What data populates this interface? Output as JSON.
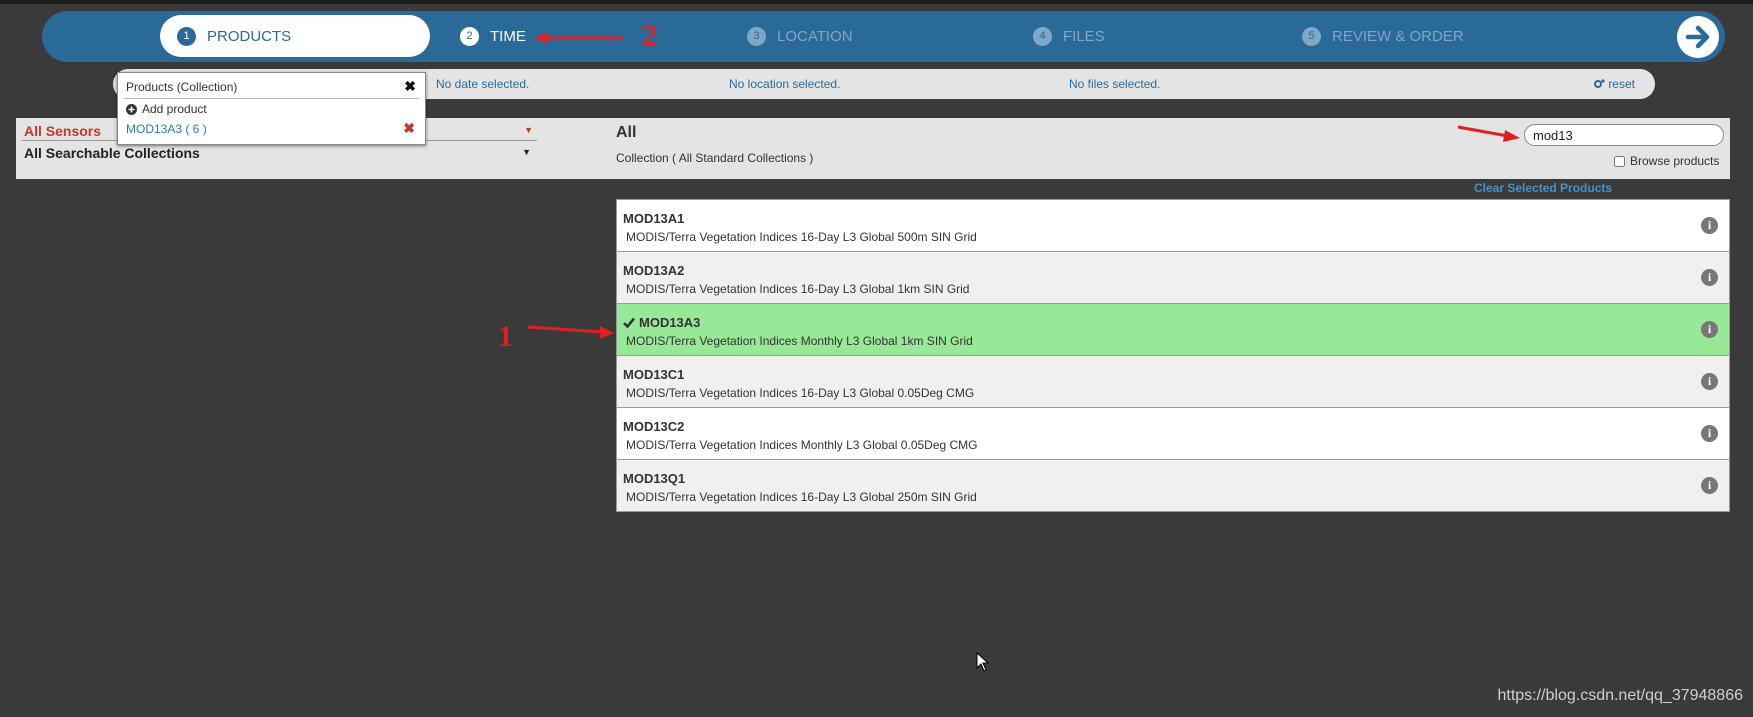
{
  "steps": [
    {
      "num": "1",
      "label": "PRODUCTS"
    },
    {
      "num": "2",
      "label": "TIME"
    },
    {
      "num": "3",
      "label": "LOCATION"
    },
    {
      "num": "4",
      "label": "FILES"
    },
    {
      "num": "5",
      "label": "REVIEW & ORDER"
    }
  ],
  "summary": {
    "date": "No date selected.",
    "location": "No location selected.",
    "files": "No files selected.",
    "reset": "reset"
  },
  "popup": {
    "title": "Products (Collection)",
    "close": "✖",
    "add": "Add product",
    "item": "MOD13A3 ( 6 )",
    "remove": "✖"
  },
  "filters": {
    "sensor": "All Sensors",
    "collection": "All Searchable Collections",
    "heading": "All",
    "subheading": "Collection ( All Standard Collections )",
    "search_value": "mod13",
    "browse_label": "Browse products",
    "clear": "Clear Selected Products"
  },
  "products": [
    {
      "name": "MOD13A1",
      "desc": "MODIS/Terra Vegetation Indices 16-Day L3 Global 500m SIN Grid",
      "selected": false
    },
    {
      "name": "MOD13A2",
      "desc": "MODIS/Terra Vegetation Indices 16-Day L3 Global 1km SIN Grid",
      "selected": false
    },
    {
      "name": "MOD13A3",
      "desc": "MODIS/Terra Vegetation Indices Monthly L3 Global 1km SIN Grid",
      "selected": true
    },
    {
      "name": "MOD13C1",
      "desc": "MODIS/Terra Vegetation Indices 16-Day L3 Global 0.05Deg CMG",
      "selected": false
    },
    {
      "name": "MOD13C2",
      "desc": "MODIS/Terra Vegetation Indices Monthly L3 Global 0.05Deg CMG",
      "selected": false
    },
    {
      "name": "MOD13Q1",
      "desc": "MODIS/Terra Vegetation Indices 16-Day L3 Global 250m SIN Grid",
      "selected": false
    }
  ],
  "annotations": {
    "one": "1",
    "two": "2"
  },
  "watermark": "https://blog.csdn.net/qq_37948866",
  "colors": {
    "accent": "#2a6a98",
    "selected_row": "#97e997",
    "annotation": "#e02020"
  }
}
